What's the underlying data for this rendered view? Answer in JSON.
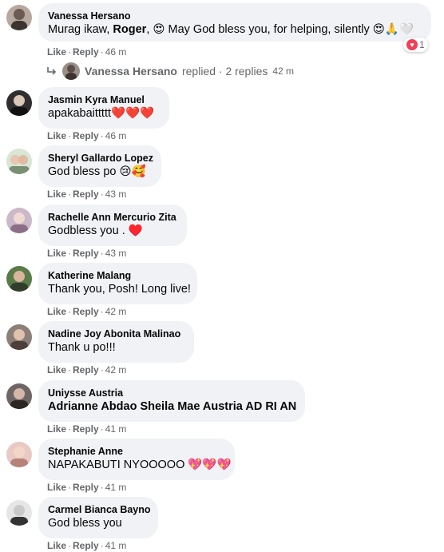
{
  "comments": [
    {
      "author": "Vanessa Hersano",
      "text_pre": "Murag ikaw, ",
      "text_bold": "Roger",
      "text_post": ", 😍 May God bless you, for helping, silently 😍🙏🤍",
      "like": "Like",
      "reply": "Reply",
      "time": "46 m",
      "reaction_count": "1",
      "replies": {
        "author": "Vanessa Hersano",
        "label": "replied · 2 replies",
        "time": "42 m"
      }
    },
    {
      "author": "Jasmin Kyra Manuel",
      "text": "apakabaittttt❤️❤️❤️",
      "like": "Like",
      "reply": "Reply",
      "time": "46 m"
    },
    {
      "author": "Sheryl Gallardo Lopez",
      "text": "God bless po 😢🥰",
      "like": "Like",
      "reply": "Reply",
      "time": "43 m"
    },
    {
      "author": "Rachelle Ann Mercurio Zita",
      "text": "Godbless you . ♥️",
      "like": "Like",
      "reply": "Reply",
      "time": "43 m"
    },
    {
      "author": "Katherine Malang",
      "text": "Thank you, Posh! Long live!",
      "like": "Like",
      "reply": "Reply",
      "time": "42 m"
    },
    {
      "author": "Nadine Joy Abonita Malinao",
      "text": "Thank u po!!!",
      "like": "Like",
      "reply": "Reply",
      "time": "42 m"
    },
    {
      "author": "Uniysse Austria",
      "text": "Adrianne Abdao Sheila Mae Austria AD RI AN",
      "like": "Like",
      "reply": "Reply",
      "time": "41 m"
    },
    {
      "author": "Stephanie Anne",
      "text": "NAPAKABUTI NYOOOOO 💖💖💖",
      "like": "Like",
      "reply": "Reply",
      "time": "41 m"
    },
    {
      "author": "Carmel Bianca Bayno",
      "text": "God bless you",
      "like": "Like",
      "reply": "Reply",
      "time": "41 m"
    }
  ],
  "colors": {
    "bubble": "#f0f2f5",
    "meta": "#65676b",
    "heart": "#f33e58"
  },
  "icons": {
    "reply-arrow": "reply-arrow-icon",
    "heart-reaction": "heart-reaction-icon"
  }
}
